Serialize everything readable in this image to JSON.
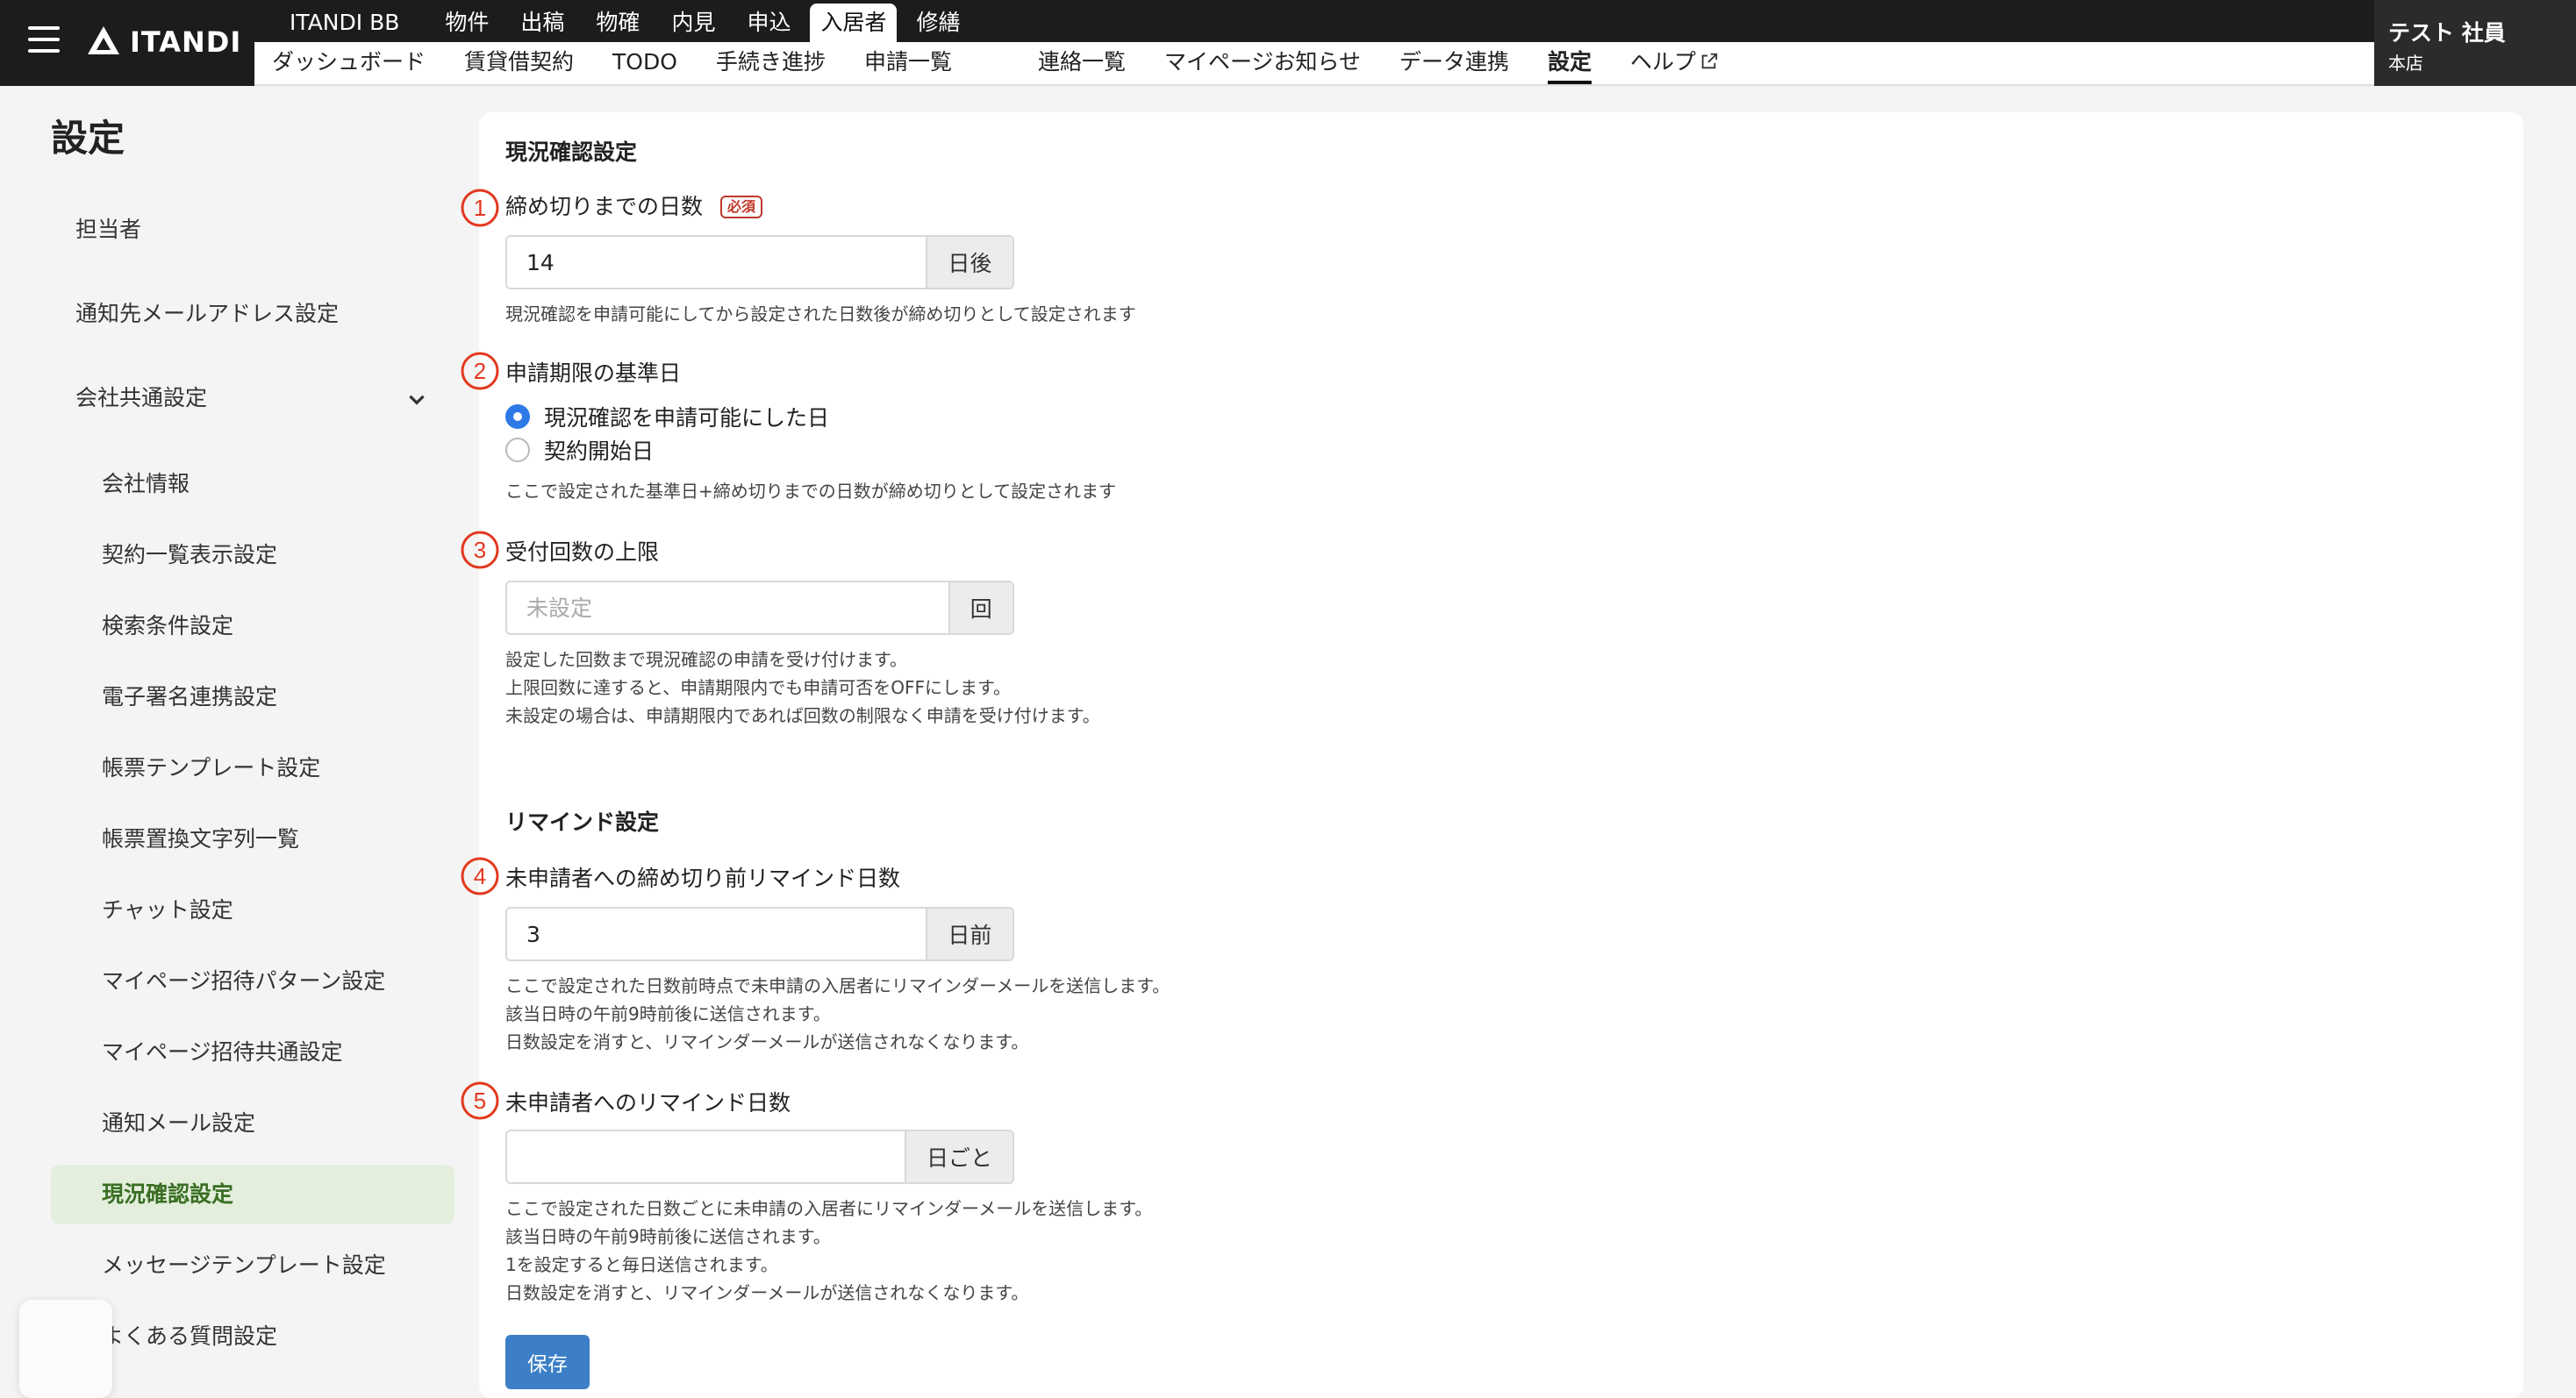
{
  "header": {
    "logo_text": "ITANDI",
    "top_tabs": [
      "ITANDI BB",
      "物件",
      "出稿",
      "物確",
      "内見",
      "申込",
      "入居者",
      "修繕"
    ],
    "active_top_tab": "入居者",
    "sub_nav": [
      "ダッシュボード",
      "賃貸借契約",
      "TODO",
      "手続き進捗",
      "申請一覧",
      "連絡一覧",
      "マイページお知らせ",
      "データ連携",
      "設定",
      "ヘルプ"
    ],
    "active_sub_nav": "設定",
    "user": {
      "name": "テスト 社員",
      "store": "本店"
    }
  },
  "page_title": "設定",
  "sidebar": {
    "items": [
      "担当者",
      "通知先メールアドレス設定",
      "会社共通設定"
    ],
    "sub_items": [
      "会社情報",
      "契約一覧表示設定",
      "検索条件設定",
      "電子署名連携設定",
      "帳票テンプレート設定",
      "帳票置換文字列一覧",
      "チャット設定",
      "マイページ招待パターン設定",
      "マイページ招待共通設定",
      "通知メール設定",
      "現況確認設定",
      "メッセージテンプレート設定",
      "よくある質問設定"
    ],
    "active": "現況確認設定"
  },
  "form": {
    "section1_title": "現況確認設定",
    "deadline": {
      "badge": "1",
      "label": "締め切りまでの日数",
      "required": "必須",
      "value": "14",
      "unit": "日後",
      "help": "現況確認を申請可能にしてから設定された日数後が締め切りとして設定されます"
    },
    "base_date": {
      "badge": "2",
      "label": "申請期限の基準日",
      "options": [
        "現況確認を申請可能にした日",
        "契約開始日"
      ],
      "selected": 0,
      "help": "ここで設定された基準日+締め切りまでの日数が締め切りとして設定されます"
    },
    "limit": {
      "badge": "3",
      "label": "受付回数の上限",
      "value": "",
      "placeholder": "未設定",
      "unit": "回",
      "help": [
        "設定した回数まで現況確認の申請を受け付けます。",
        "上限回数に達すると、申請期限内でも申請可否をOFFにします。",
        "未設定の場合は、申請期限内であれば回数の制限なく申請を受け付けます。"
      ]
    },
    "section2_title": "リマインド設定",
    "remind_before": {
      "badge": "4",
      "label": "未申請者への締め切り前リマインド日数",
      "value": "3",
      "unit": "日前",
      "help": [
        "ここで設定された日数前時点で未申請の入居者にリマインダーメールを送信します。",
        "該当日時の午前9時前後に送信されます。",
        "日数設定を消すと、リマインダーメールが送信されなくなります。"
      ]
    },
    "remind_interval": {
      "badge": "5",
      "label": "未申請者へのリマインド日数",
      "value": "",
      "unit": "日ごと",
      "help": [
        "ここで設定された日数ごとに未申請の入居者にリマインダーメールを送信します。",
        "該当日時の午前9時前後に送信されます。",
        "1を設定すると毎日送信されます。",
        "日数設定を消すと、リマインダーメールが送信されなくなります。"
      ]
    },
    "save_label": "保存"
  },
  "colors": {
    "badge_red": "#e2391f",
    "active_bg": "#e3efdc",
    "primary": "#3d7fc6"
  }
}
